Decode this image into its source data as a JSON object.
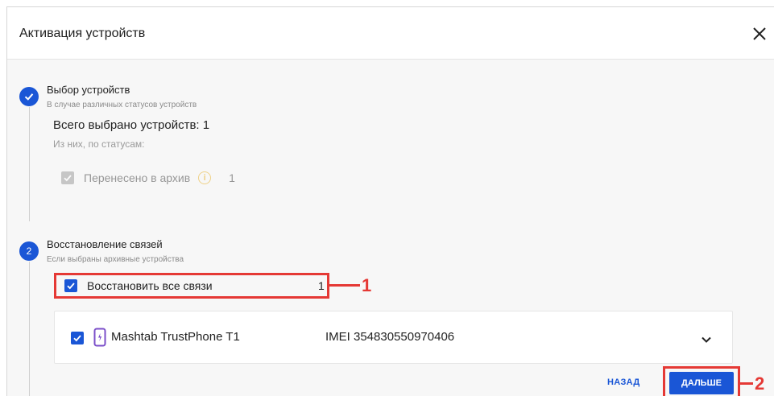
{
  "dialog": {
    "title": "Активация устройств",
    "close_icon": "close-icon"
  },
  "steps": [
    {
      "title": "Выбор устройств",
      "subtitle": "В случае различных статусов устройств",
      "state": "done"
    },
    {
      "number": "2",
      "title": "Восстановление связей",
      "subtitle": "Если выбраны архивные устройства",
      "state": "active"
    }
  ],
  "summary": {
    "total": "Всего выбрано устройств: 1",
    "by_status": "Из них, по статусам:",
    "archive_label": "Перенесено в архив",
    "archive_count": "1",
    "archive_checked": true
  },
  "restore": {
    "label": "Восстановить все связи",
    "count": "1",
    "checked": true
  },
  "device": {
    "name": "Mashtab TrustPhone T1",
    "imei": "IMEI 354830550970406",
    "checked": true,
    "icon": "smartphone-icon"
  },
  "buttons": {
    "back": "НАЗАД",
    "next": "ДАЛЬШЕ"
  },
  "callouts": {
    "one": "1",
    "two": "2"
  },
  "colors": {
    "accent": "#1a56d6",
    "callout": "#e53935",
    "warning": "#e5a400"
  }
}
